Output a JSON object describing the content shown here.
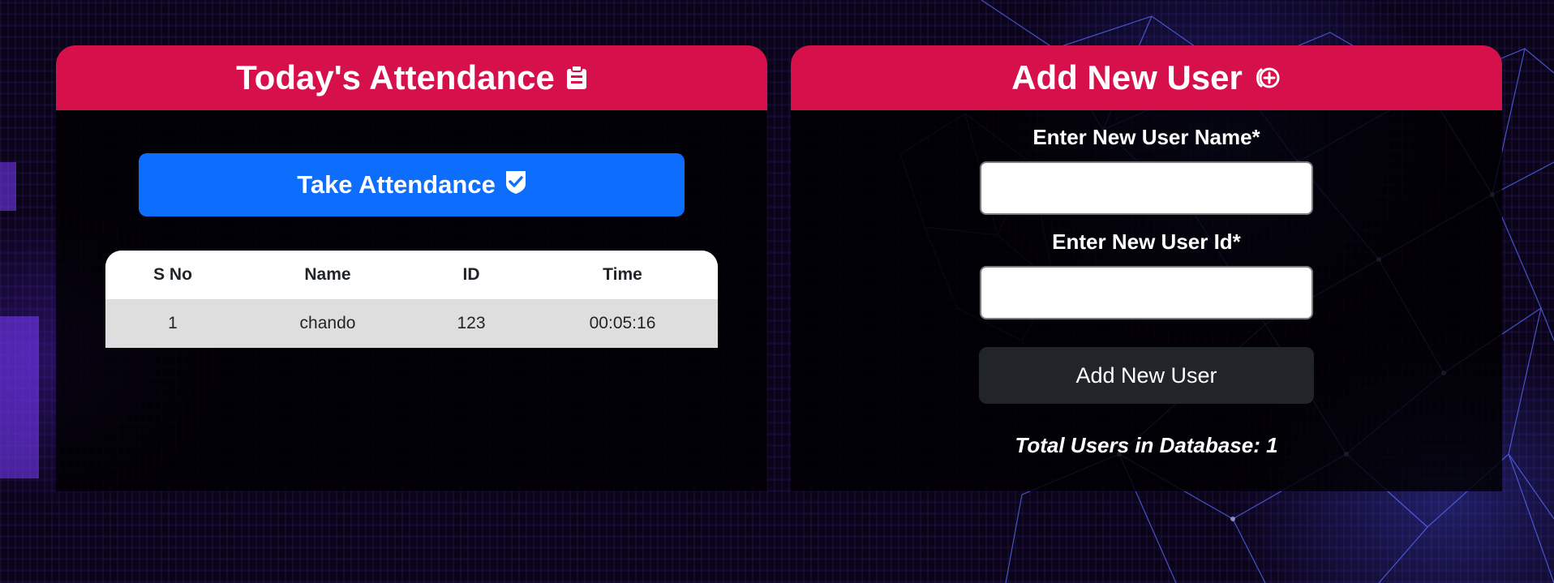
{
  "attendance_panel": {
    "title": "Today's Attendance",
    "title_icon": "clipboard-icon",
    "take_button": {
      "label": "Take Attendance",
      "icon": "shield-check-icon",
      "color": "#0d6efd"
    },
    "table": {
      "headers": [
        "S No",
        "Name",
        "ID",
        "Time"
      ],
      "rows": [
        [
          "1",
          "chando",
          "123",
          "00:05:16"
        ]
      ]
    }
  },
  "add_user_panel": {
    "title": "Add New User",
    "title_icon": "plus-circle-icon",
    "name_label": "Enter New User Name*",
    "name_value": "",
    "id_label": "Enter New User Id*",
    "id_value": "",
    "submit_label": "Add New User",
    "total_users_text": "Total Users in Database: 1"
  },
  "colors": {
    "header": "#d6104b",
    "primary_button": "#0d6efd",
    "dark_button": "#212529"
  }
}
